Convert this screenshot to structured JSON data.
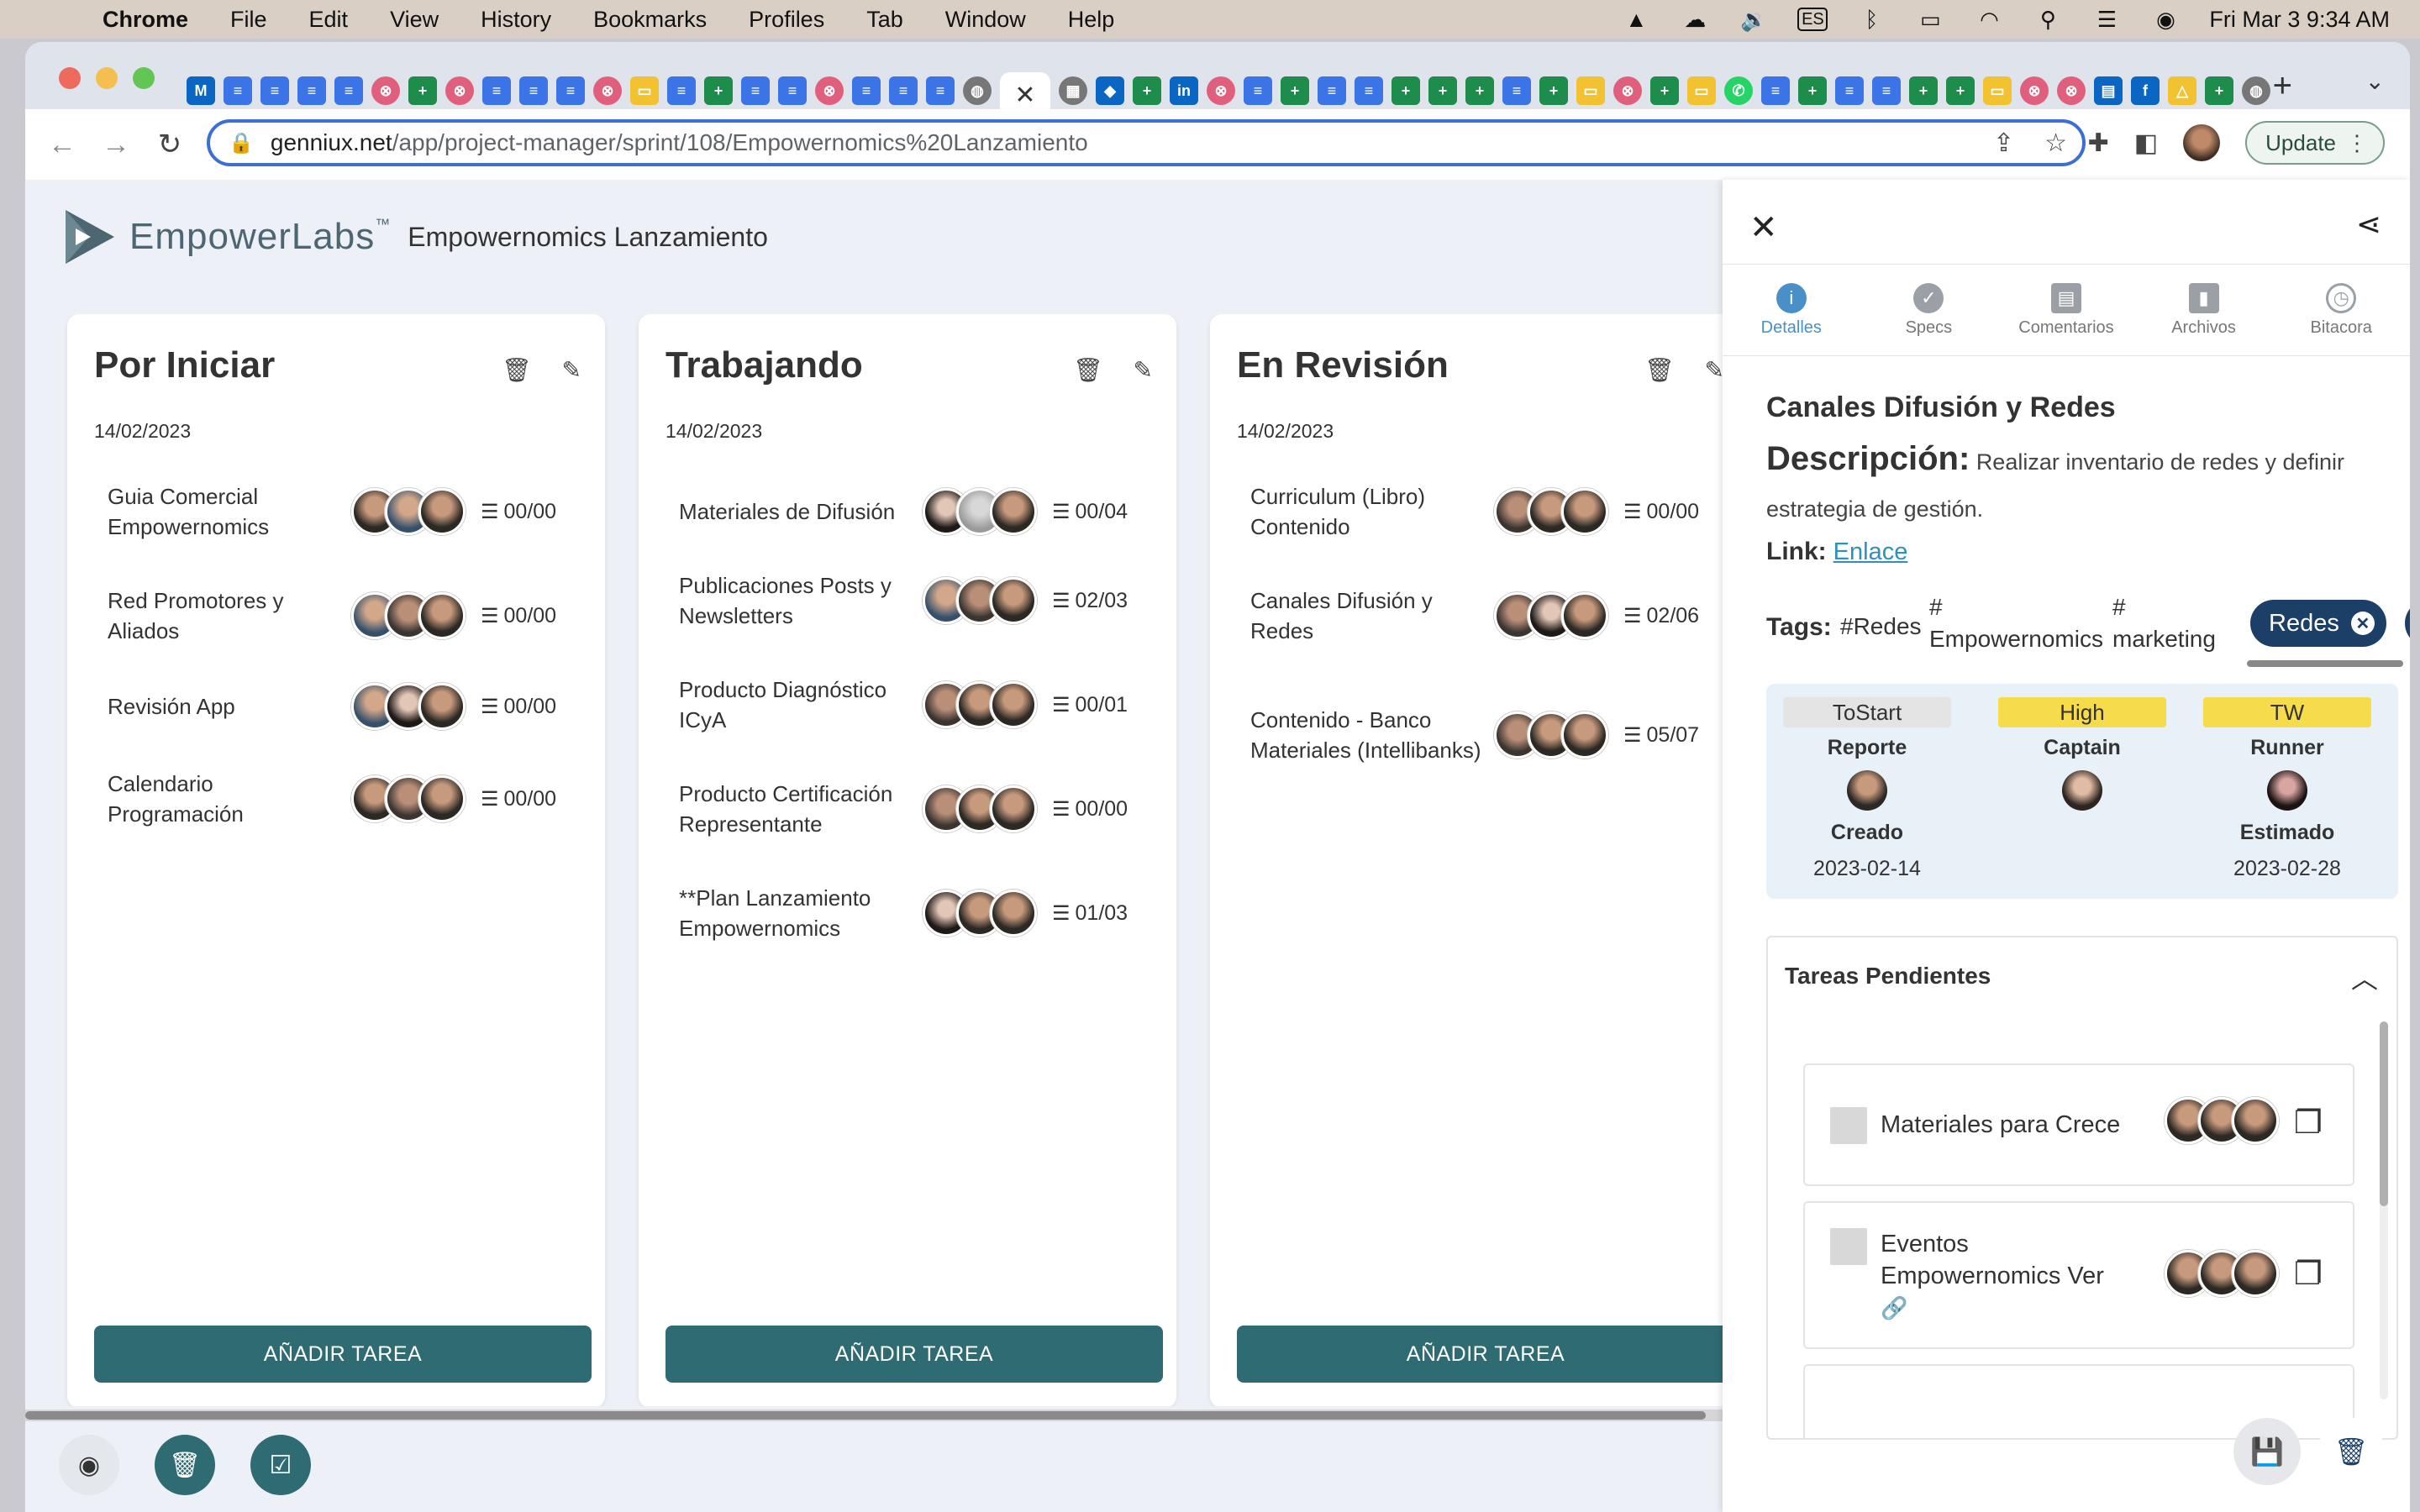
{
  "menubar": {
    "app": "Chrome",
    "items": [
      "File",
      "Edit",
      "View",
      "History",
      "Bookmarks",
      "Profiles",
      "Tab",
      "Window",
      "Help"
    ],
    "input_source": "ES",
    "clock": "Fri Mar 3  9:34 AM"
  },
  "browser": {
    "url_host": "genniux.net",
    "url_path": "/app/project-manager/sprint/108/Empowernomics%20Lanzamiento",
    "update_label": "Update"
  },
  "app": {
    "brand": "EmpowerLabs",
    "trademark": "™",
    "project": "Empowernomics Lanzamiento"
  },
  "columns": [
    {
      "title": "Por Iniciar",
      "date": "14/02/2023",
      "add_label": "AÑADIR TAREA",
      "tasks": [
        {
          "name": "Guia Comercial Empowernomics",
          "progress": "00/00"
        },
        {
          "name": "Red Promotores y Aliados",
          "progress": "00/00"
        },
        {
          "name": "Revisión App",
          "progress": "00/00"
        },
        {
          "name": "Calendario Programación",
          "progress": "00/00"
        }
      ]
    },
    {
      "title": "Trabajando",
      "date": "14/02/2023",
      "add_label": "AÑADIR TAREA",
      "tasks": [
        {
          "name": "Materiales de Difusión",
          "progress": "00/04"
        },
        {
          "name": "Publicaciones Posts y Newsletters",
          "progress": "02/03"
        },
        {
          "name": "Producto Diagnóstico ICyA",
          "progress": "00/01"
        },
        {
          "name": "Producto Certificación Representante",
          "progress": "00/00"
        },
        {
          "name": "**Plan Lanzamiento Empowernomics",
          "progress": "01/03"
        }
      ]
    },
    {
      "title": "En Revisión",
      "date": "14/02/2023",
      "add_label": "AÑADIR TAREA",
      "tasks": [
        {
          "name": "Curriculum (Libro) Contenido",
          "progress": "00/00"
        },
        {
          "name": "Canales Difusión y Redes",
          "progress": "02/06"
        },
        {
          "name": "Contenido - Banco Materiales (Intellibanks)",
          "progress": "05/07"
        }
      ]
    }
  ],
  "drawer": {
    "tabs": [
      "Detalles",
      "Specs",
      "Comentarios",
      "Archivos",
      "Bitacora"
    ],
    "active_tab": "Detalles",
    "title": "Canales Difusión y Redes",
    "description_label": "Descripción:",
    "description": "Realizar inventario de redes y definir estrategia de gestión.",
    "link_label": "Link:",
    "link_text": "Enlace",
    "tags_label": "Tags:",
    "tags": [
      "#Redes",
      "#\nEmpowernomics",
      "#\nmarketing"
    ],
    "selected_tag": "Redes",
    "status": "ToStart",
    "priority": "High",
    "team": "TW",
    "roles": [
      "Reporte",
      "Captain",
      "Runner"
    ],
    "created_label": "Creado",
    "created": "2023-02-14",
    "estimated_label": "Estimado",
    "estimated": "2023-02-28",
    "pending_title": "Tareas Pendientes",
    "pending": [
      {
        "name": "Materiales para Crece"
      },
      {
        "name": "Eventos Empowernomics Ver"
      }
    ]
  }
}
